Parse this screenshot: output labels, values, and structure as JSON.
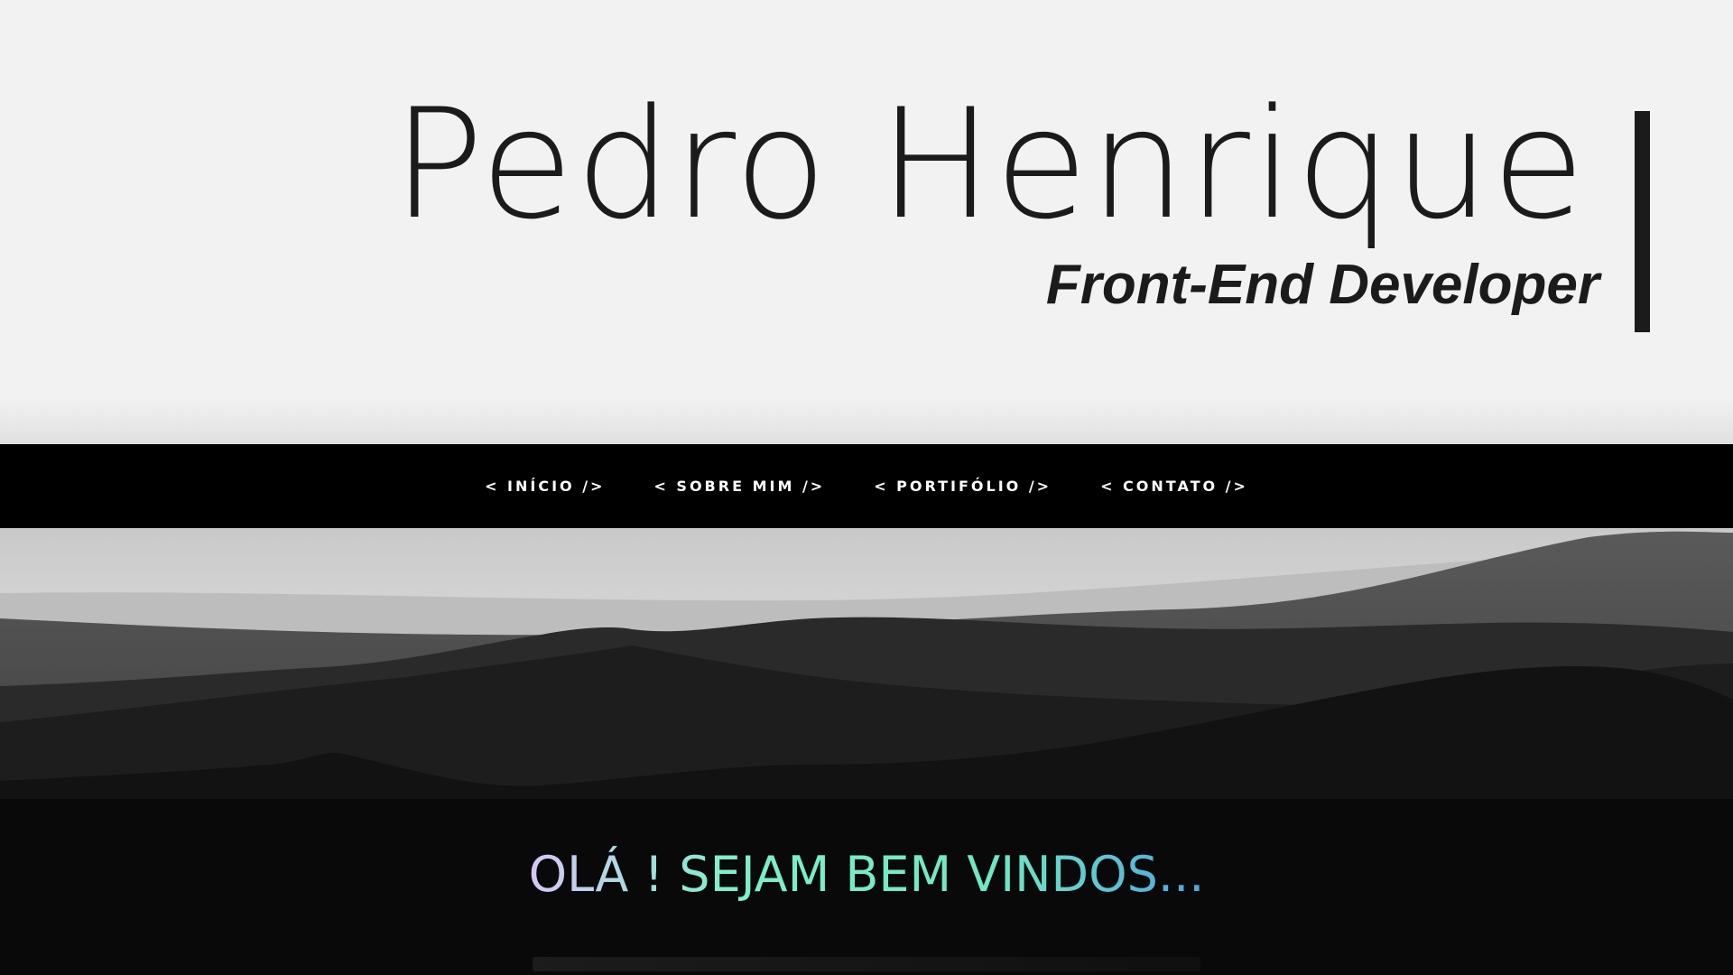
{
  "header": {
    "name": "Pedro Henrique",
    "role": "Front-End Developer"
  },
  "nav": {
    "items": [
      {
        "label": "< INÍCIO />"
      },
      {
        "label": "< SOBRE MIM />"
      },
      {
        "label": "< PORTIFÓLIO />"
      },
      {
        "label": "< CONTATO />"
      }
    ]
  },
  "hero": {
    "welcome": "OLÁ ! SEJAM BEM VINDOS..."
  },
  "colors": {
    "header_bg": "#f2f2f2",
    "nav_bg": "#000000",
    "text_dark": "#1b1b1b",
    "gradient_start": "#d7c6f7",
    "gradient_mid": "#7df0c8",
    "gradient_end": "#4fa3e0"
  }
}
